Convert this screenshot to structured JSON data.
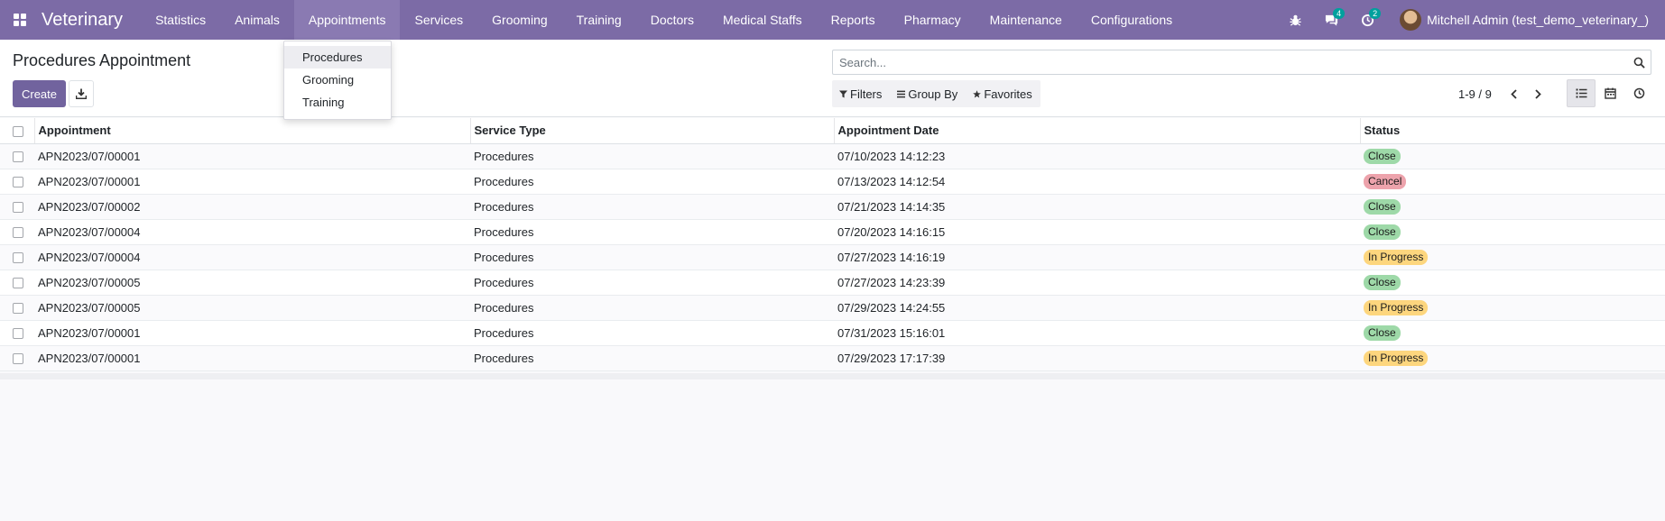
{
  "app": {
    "name": "Veterinary",
    "menu": [
      "Statistics",
      "Animals",
      "Appointments",
      "Services",
      "Grooming",
      "Training",
      "Doctors",
      "Medical Staffs",
      "Reports",
      "Pharmacy",
      "Maintenance",
      "Configurations"
    ],
    "active_menu": "Appointments"
  },
  "systray": {
    "bug_icon": "bug-icon",
    "messages_icon": "chat-icon",
    "messages_count": "4",
    "activities_icon": "clock-icon",
    "activities_count": "2",
    "user_name": "Mitchell Admin (test_demo_veterinary_)"
  },
  "dropdown": {
    "items": [
      "Procedures",
      "Grooming",
      "Training"
    ],
    "highlighted": "Procedures"
  },
  "control_panel": {
    "title": "Procedures Appointment",
    "create_label": "Create",
    "download_icon": "download-icon",
    "search_placeholder": "Search...",
    "filters_label": "Filters",
    "group_by_label": "Group By",
    "favorites_label": "Favorites",
    "pager": "1-9 / 9"
  },
  "table": {
    "columns": [
      "Appointment",
      "Service Type",
      "Appointment Date",
      "Status"
    ],
    "rows": [
      {
        "appointment": "APN2023/07/00001",
        "service_type": "Procedures",
        "date": "07/10/2023 14:12:23",
        "status": "Close"
      },
      {
        "appointment": "APN2023/07/00001",
        "service_type": "Procedures",
        "date": "07/13/2023 14:12:54",
        "status": "Cancel"
      },
      {
        "appointment": "APN2023/07/00002",
        "service_type": "Procedures",
        "date": "07/21/2023 14:14:35",
        "status": "Close"
      },
      {
        "appointment": "APN2023/07/00004",
        "service_type": "Procedures",
        "date": "07/20/2023 14:16:15",
        "status": "Close"
      },
      {
        "appointment": "APN2023/07/00004",
        "service_type": "Procedures",
        "date": "07/27/2023 14:16:19",
        "status": "In Progress"
      },
      {
        "appointment": "APN2023/07/00005",
        "service_type": "Procedures",
        "date": "07/27/2023 14:23:39",
        "status": "Close"
      },
      {
        "appointment": "APN2023/07/00005",
        "service_type": "Procedures",
        "date": "07/29/2023 14:24:55",
        "status": "In Progress"
      },
      {
        "appointment": "APN2023/07/00001",
        "service_type": "Procedures",
        "date": "07/31/2023 15:16:01",
        "status": "Close"
      },
      {
        "appointment": "APN2023/07/00001",
        "service_type": "Procedures",
        "date": "07/29/2023 17:17:39",
        "status": "In Progress"
      }
    ]
  },
  "colors": {
    "navbar": "#7c6ba6",
    "primary": "#71639e",
    "status_close": "#9ed9a8",
    "status_cancel": "#eda3ac",
    "status_in_progress": "#fdd67e"
  }
}
